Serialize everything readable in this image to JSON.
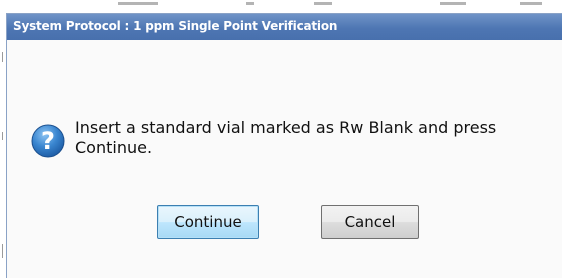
{
  "dialog": {
    "title": "System Protocol : 1 ppm Single Point Verification",
    "icon": "question-icon",
    "message": "Insert a standard vial marked as Rw Blank and press Continue.",
    "buttons": {
      "continue_label": "Continue",
      "cancel_label": "Cancel"
    }
  },
  "colors": {
    "titlebar": "#4e76b3",
    "title_text": "#ffffff",
    "icon": "#2f78c4",
    "default_button_border": "#3c7fb1"
  }
}
